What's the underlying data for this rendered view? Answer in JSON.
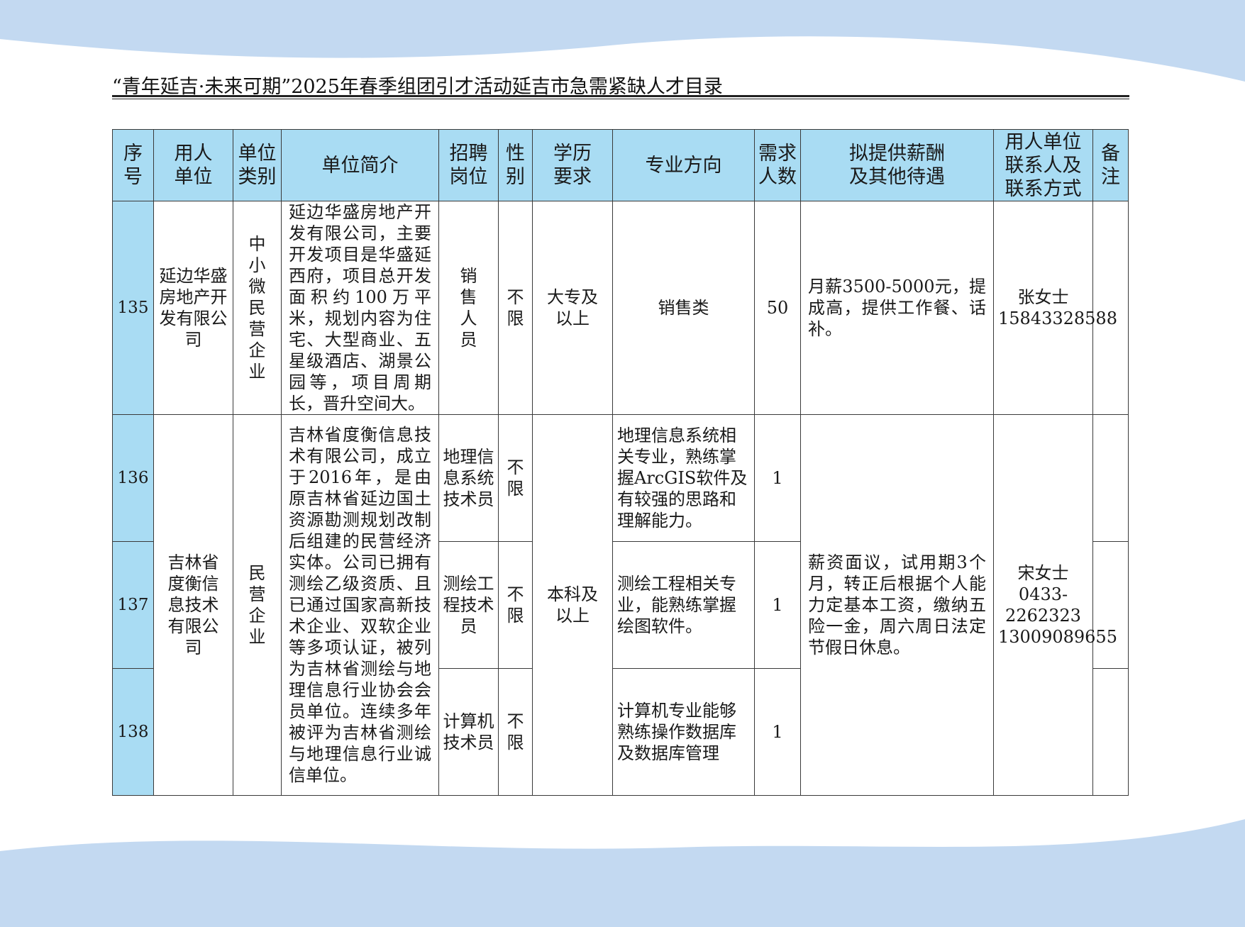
{
  "page_title": "“青年延吉·未来可期”2025年春季组团引才活动延吉市急需紧缺人才目录",
  "colors": {
    "header_bg": "#a9dcf3",
    "wave": "#c3d9f1"
  },
  "columns": [
    "序号",
    "用人单位",
    "单位类别",
    "单位简介",
    "招聘岗位",
    "性别",
    "学历要求",
    "专业方向",
    "需求人数",
    "拟提供薪酬及其他待遇",
    "用人单位联系人及联系方式",
    "备注"
  ],
  "rows": [
    {
      "no": "135",
      "unit": "延边华盛房地产开发有限公司",
      "category": "中小微民营企业",
      "intro": "延边华盛房地产开发有限公司，主要开发项目是华盛延西府，项目总开发面积约100万平米，规划内容为住宅、大型商业、五星级酒店、湖景公园等，项目周期长，晋升空间大。",
      "position": "销售人员",
      "gender": "不限",
      "education": "大专及以上",
      "major": "销售类",
      "count": "50",
      "salary": "月薪3500-5000元，提成高，提供工作餐、话补。",
      "contact": "张女士 15843328588",
      "remark": ""
    },
    {
      "no": "136",
      "unit": "吉林省度衡信息技术有限公司",
      "category": "民营企业",
      "intro": "吉林省度衡信息技术有限公司，成立于2016年，是由原吉林省延边国土资源勘测规划改制后组建的民营经济实体。公司已拥有测绘乙级资质、且已通过国家高新技术企业、双软企业等多项认证，被列为吉林省测绘与地理信息行业协会会员单位。连续多年被评为吉林省测绘与地理信息行业诚信单位。",
      "position": "地理信息系统技术员",
      "gender": "不限",
      "education": "本科及以上",
      "major": "地理信息系统相关专业，熟练掌握ArcGIS软件及有较强的思路和理解能力。",
      "count": "1",
      "salary": "薪资面议，试用期3个月，转正后根据个人能力定基本工资，缴纳五险一金，周六周日法定节假日休息。",
      "contact": "宋女士 0433-2262323 13009089655",
      "remark": ""
    },
    {
      "no": "137",
      "position": "测绘工程技术员",
      "gender": "不限",
      "major": "测绘工程相关专业，能熟练掌握绘图软件。",
      "count": "1",
      "remark": ""
    },
    {
      "no": "138",
      "position": "计算机技术员",
      "gender": "不限",
      "major": "计算机专业能够熟练操作数据库及数据库管理",
      "count": "1",
      "remark": ""
    }
  ]
}
